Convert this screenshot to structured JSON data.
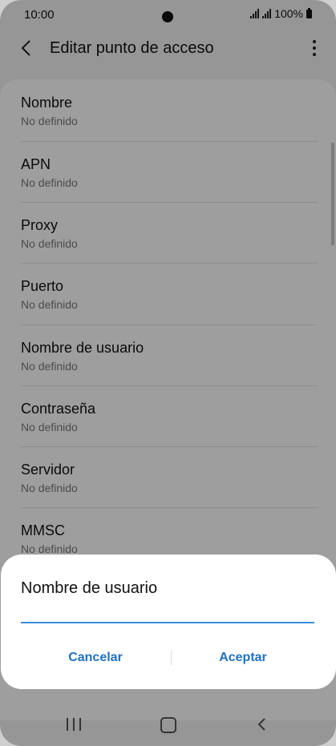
{
  "status_bar": {
    "time": "10:00",
    "battery": "100%"
  },
  "app_bar": {
    "title": "Editar punto de acceso"
  },
  "list": {
    "items": [
      {
        "title": "Nombre",
        "subtitle": "No definido"
      },
      {
        "title": "APN",
        "subtitle": "No definido"
      },
      {
        "title": "Proxy",
        "subtitle": "No definido"
      },
      {
        "title": "Puerto",
        "subtitle": "No definido"
      },
      {
        "title": "Nombre de usuario",
        "subtitle": "No definido"
      },
      {
        "title": "Contraseña",
        "subtitle": "No definido"
      },
      {
        "title": "Servidor",
        "subtitle": "No definido"
      },
      {
        "title": "MMSC",
        "subtitle": "No definido"
      }
    ]
  },
  "dialog": {
    "title": "Nombre de usuario",
    "input_value": "",
    "cancel_label": "Cancelar",
    "accept_label": "Aceptar"
  },
  "colors": {
    "accent": "#1e72bf",
    "input_underline": "#3a8fd8"
  }
}
